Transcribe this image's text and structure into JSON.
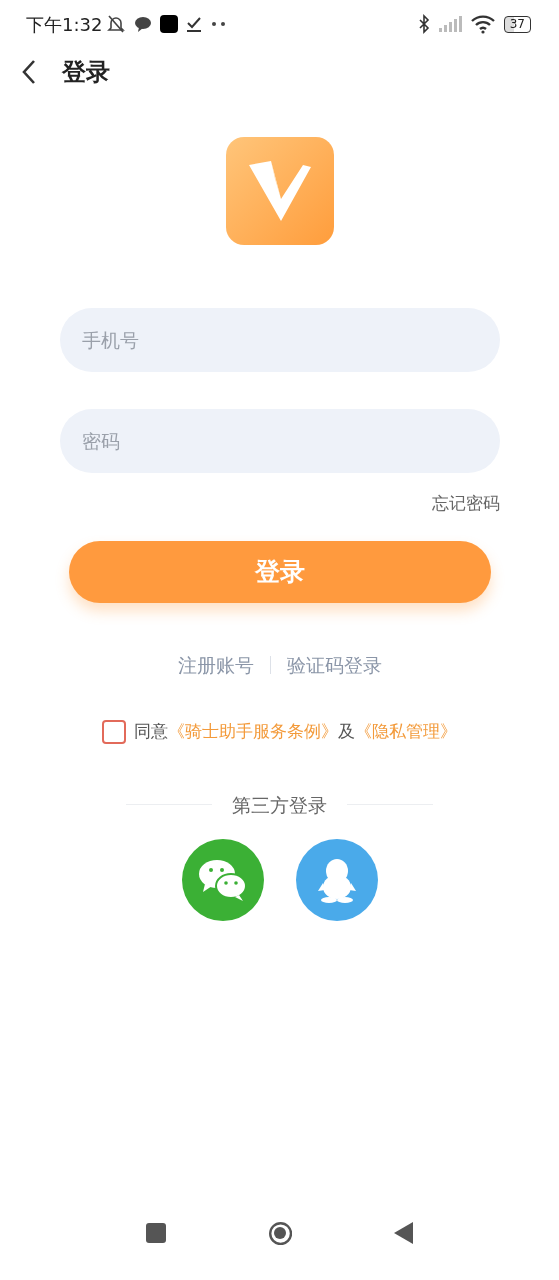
{
  "status_bar": {
    "time": "下午1:32",
    "battery": "37"
  },
  "header": {
    "title": "登录"
  },
  "form": {
    "phone": {
      "placeholder": "手机号"
    },
    "password": {
      "placeholder": "密码"
    },
    "forgot": "忘记密码",
    "submit": "登录"
  },
  "links": [
    "注册账号",
    "验证码登录"
  ],
  "agreement": {
    "checked": false,
    "parts": [
      {
        "kind": "text",
        "text": "同意"
      },
      {
        "kind": "link",
        "text": "《骑士助手服务条例》"
      },
      {
        "kind": "text",
        "text": "及"
      },
      {
        "kind": "link",
        "text": "《隐私管理》"
      }
    ]
  },
  "third_party": {
    "title": "第三方登录",
    "providers": [
      {
        "kind": "wechat",
        "color": "#3bb035"
      },
      {
        "kind": "qq",
        "color": "#4aaaea"
      }
    ]
  }
}
